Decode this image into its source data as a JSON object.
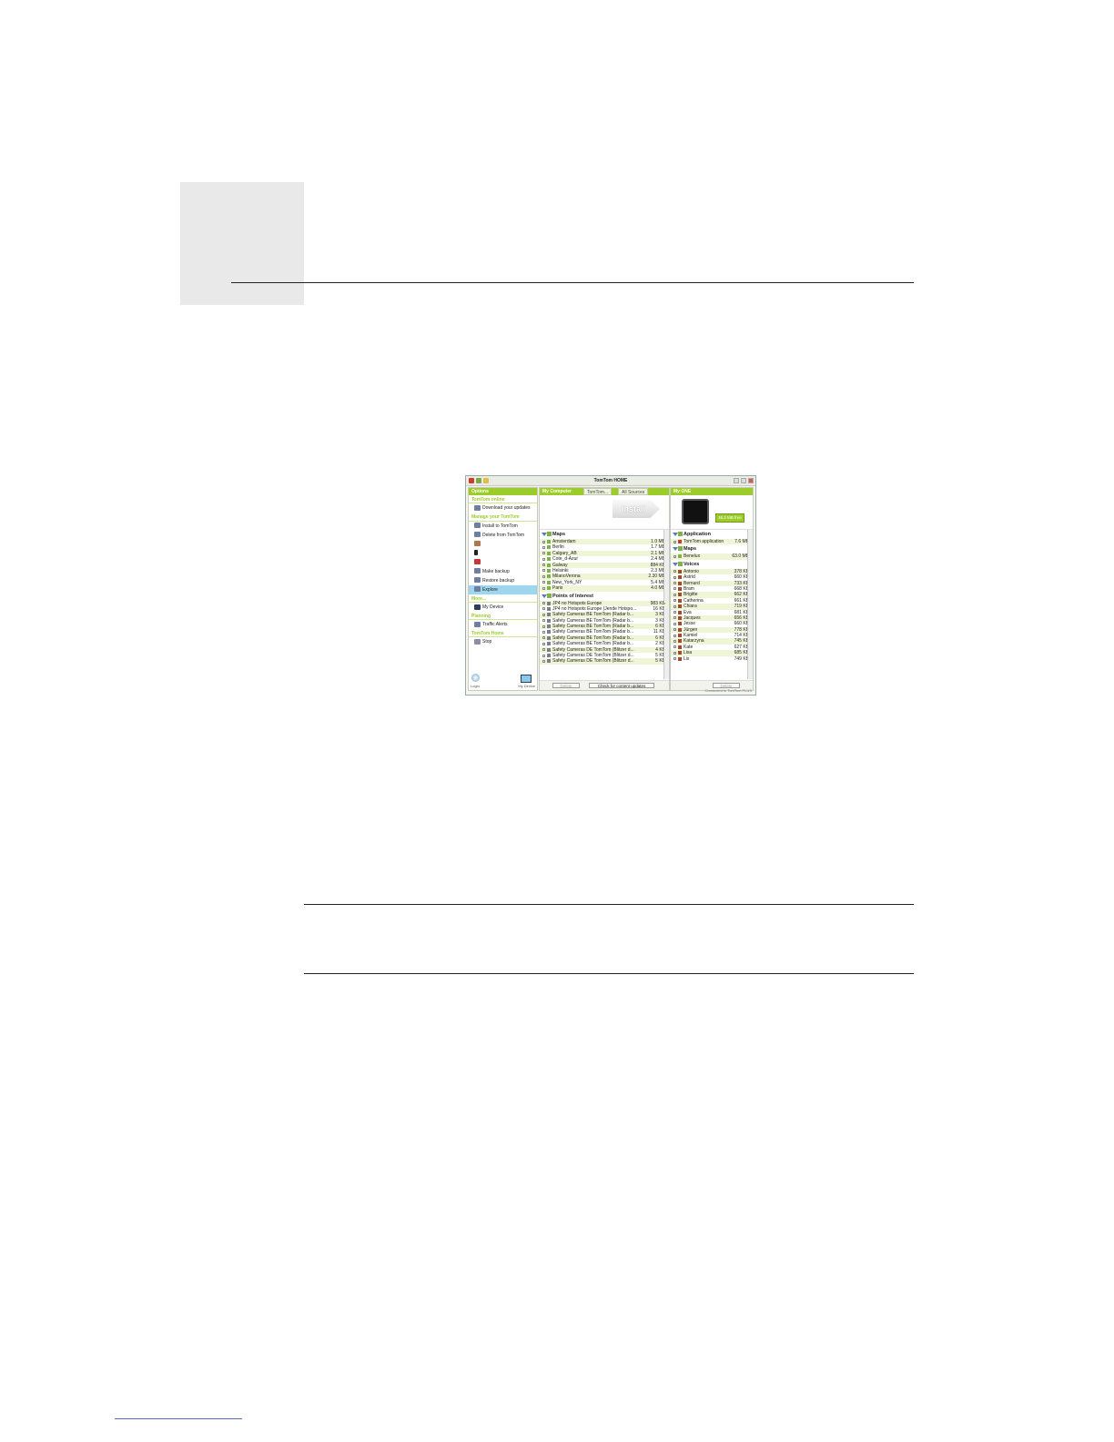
{
  "window": {
    "title": "TomTom HOME",
    "footer_note": "Connected to TomTom PLUS"
  },
  "left_panel": {
    "header": "Options",
    "sections": [
      {
        "title": "TomTom online",
        "items": [
          {
            "label": "Download your updates",
            "icon": "download-icon"
          }
        ]
      },
      {
        "title": "Manage your TomTom",
        "items": [
          {
            "label": "Install to TomTom",
            "icon": "install-icon"
          },
          {
            "label": "Delete from TomTom",
            "icon": "delete-icon"
          },
          {
            "label": "",
            "icon": "photo-icon",
            "disabled": true
          },
          {
            "label": "",
            "icon": "music-icon",
            "disabled": true
          },
          {
            "label": "",
            "icon": "audiobook-icon",
            "disabled": true
          },
          {
            "label": "Make backup",
            "icon": "backup-icon"
          },
          {
            "label": "Restore backup",
            "icon": "restore-icon"
          },
          {
            "label": "Explore",
            "icon": "explore-icon",
            "selected": true
          }
        ]
      },
      {
        "title": "More...",
        "items": [
          {
            "label": "My Device",
            "icon": "device-icon"
          }
        ]
      },
      {
        "title": "Planning",
        "items": [
          {
            "label": "Traffic Alerts",
            "icon": "traffic-icon"
          }
        ]
      },
      {
        "title": "TomTom Home",
        "items": [
          {
            "label": "Stop",
            "icon": "stop-icon"
          }
        ]
      }
    ],
    "footer": {
      "login": "Login",
      "my_device": "My Device"
    }
  },
  "middle_panel": {
    "tabs": [
      "My Computer",
      "TomTom...",
      "All Sources"
    ],
    "install_label": "Install",
    "groups": [
      {
        "title": "Maps",
        "rows": [
          {
            "name": "Amsterdam",
            "size": "1.0 MB"
          },
          {
            "name": "Berlin",
            "size": "1.7 MB"
          },
          {
            "name": "Calgary_AB",
            "size": "2.1 MB"
          },
          {
            "name": "Cote_d-Azur",
            "size": "2.4 MB"
          },
          {
            "name": "Galway",
            "size": "884 KB"
          },
          {
            "name": "Helsinki",
            "size": "2.3 MB"
          },
          {
            "name": "MilanoVerona",
            "size": "2.30 MB"
          },
          {
            "name": "New_York_NY",
            "size": "5.4 MB"
          },
          {
            "name": "Paris",
            "size": "4.0 MB"
          }
        ]
      },
      {
        "title": "Points of Interest",
        "rows": [
          {
            "name": "JP4 no Hotspots Europe",
            "size": "983 KB"
          },
          {
            "name": "JP4 no Hotspots Europe (Jende Hotspo...",
            "size": "16 KB"
          },
          {
            "name": "Safety Cameras BE TomTom (Radar b...",
            "size": "3 KB"
          },
          {
            "name": "Safety Cameras BE TomTom (Radar b...",
            "size": "3 KB"
          },
          {
            "name": "Safety Cameras BE TomTom (Radar b...",
            "size": "6 KB"
          },
          {
            "name": "Safety Cameras BE TomTom (Radar b...",
            "size": "11 KB"
          },
          {
            "name": "Safety Cameras BE TomTom (Radar b...",
            "size": "6 KB"
          },
          {
            "name": "Safety Cameras BE TomTom (Radar b...",
            "size": "2 KB"
          },
          {
            "name": "Safety Cameras DE TomTom (Blitzer d...",
            "size": "4 KB"
          },
          {
            "name": "Safety Cameras DE TomTom (Blitzer d...",
            "size": "5 KB"
          },
          {
            "name": "Safety Cameras DE TomTom (Blitzer d...",
            "size": "5 KB"
          }
        ]
      }
    ],
    "buttons": {
      "delete": "Delete",
      "check": "Check for content updates"
    }
  },
  "right_panel": {
    "header": "My ONE",
    "storage": "16.2 MB free",
    "groups": [
      {
        "title": "Application",
        "rows": [
          {
            "name": "TomTom application",
            "size": "7.6 MB"
          }
        ]
      },
      {
        "title": "Maps",
        "rows": [
          {
            "name": "Benelux",
            "size": "63.0 MB"
          }
        ]
      },
      {
        "title": "Voices",
        "rows": [
          {
            "name": "Antonio",
            "size": "378 KB"
          },
          {
            "name": "Astrid",
            "size": "660 KB"
          },
          {
            "name": "Bernard",
            "size": "733 KB"
          },
          {
            "name": "Bram",
            "size": "668 KB"
          },
          {
            "name": "Brigitte",
            "size": "662 KB"
          },
          {
            "name": "Catherina",
            "size": "661 KB"
          },
          {
            "name": "Chiara",
            "size": "719 KB"
          },
          {
            "name": "Eva",
            "size": "681 KB"
          },
          {
            "name": "Jacques",
            "size": "656 KB"
          },
          {
            "name": "Jesse",
            "size": "660 KB"
          },
          {
            "name": "Jürgen",
            "size": "778 KB"
          },
          {
            "name": "Kamiel",
            "size": "714 KB"
          },
          {
            "name": "Katarzyna",
            "size": "745 KB"
          },
          {
            "name": "Kate",
            "size": "627 KB"
          },
          {
            "name": "Lisa",
            "size": "685 KB"
          },
          {
            "name": "Lix",
            "size": "749 KB"
          }
        ]
      }
    ],
    "buttons": {
      "delete": "Delete"
    }
  }
}
